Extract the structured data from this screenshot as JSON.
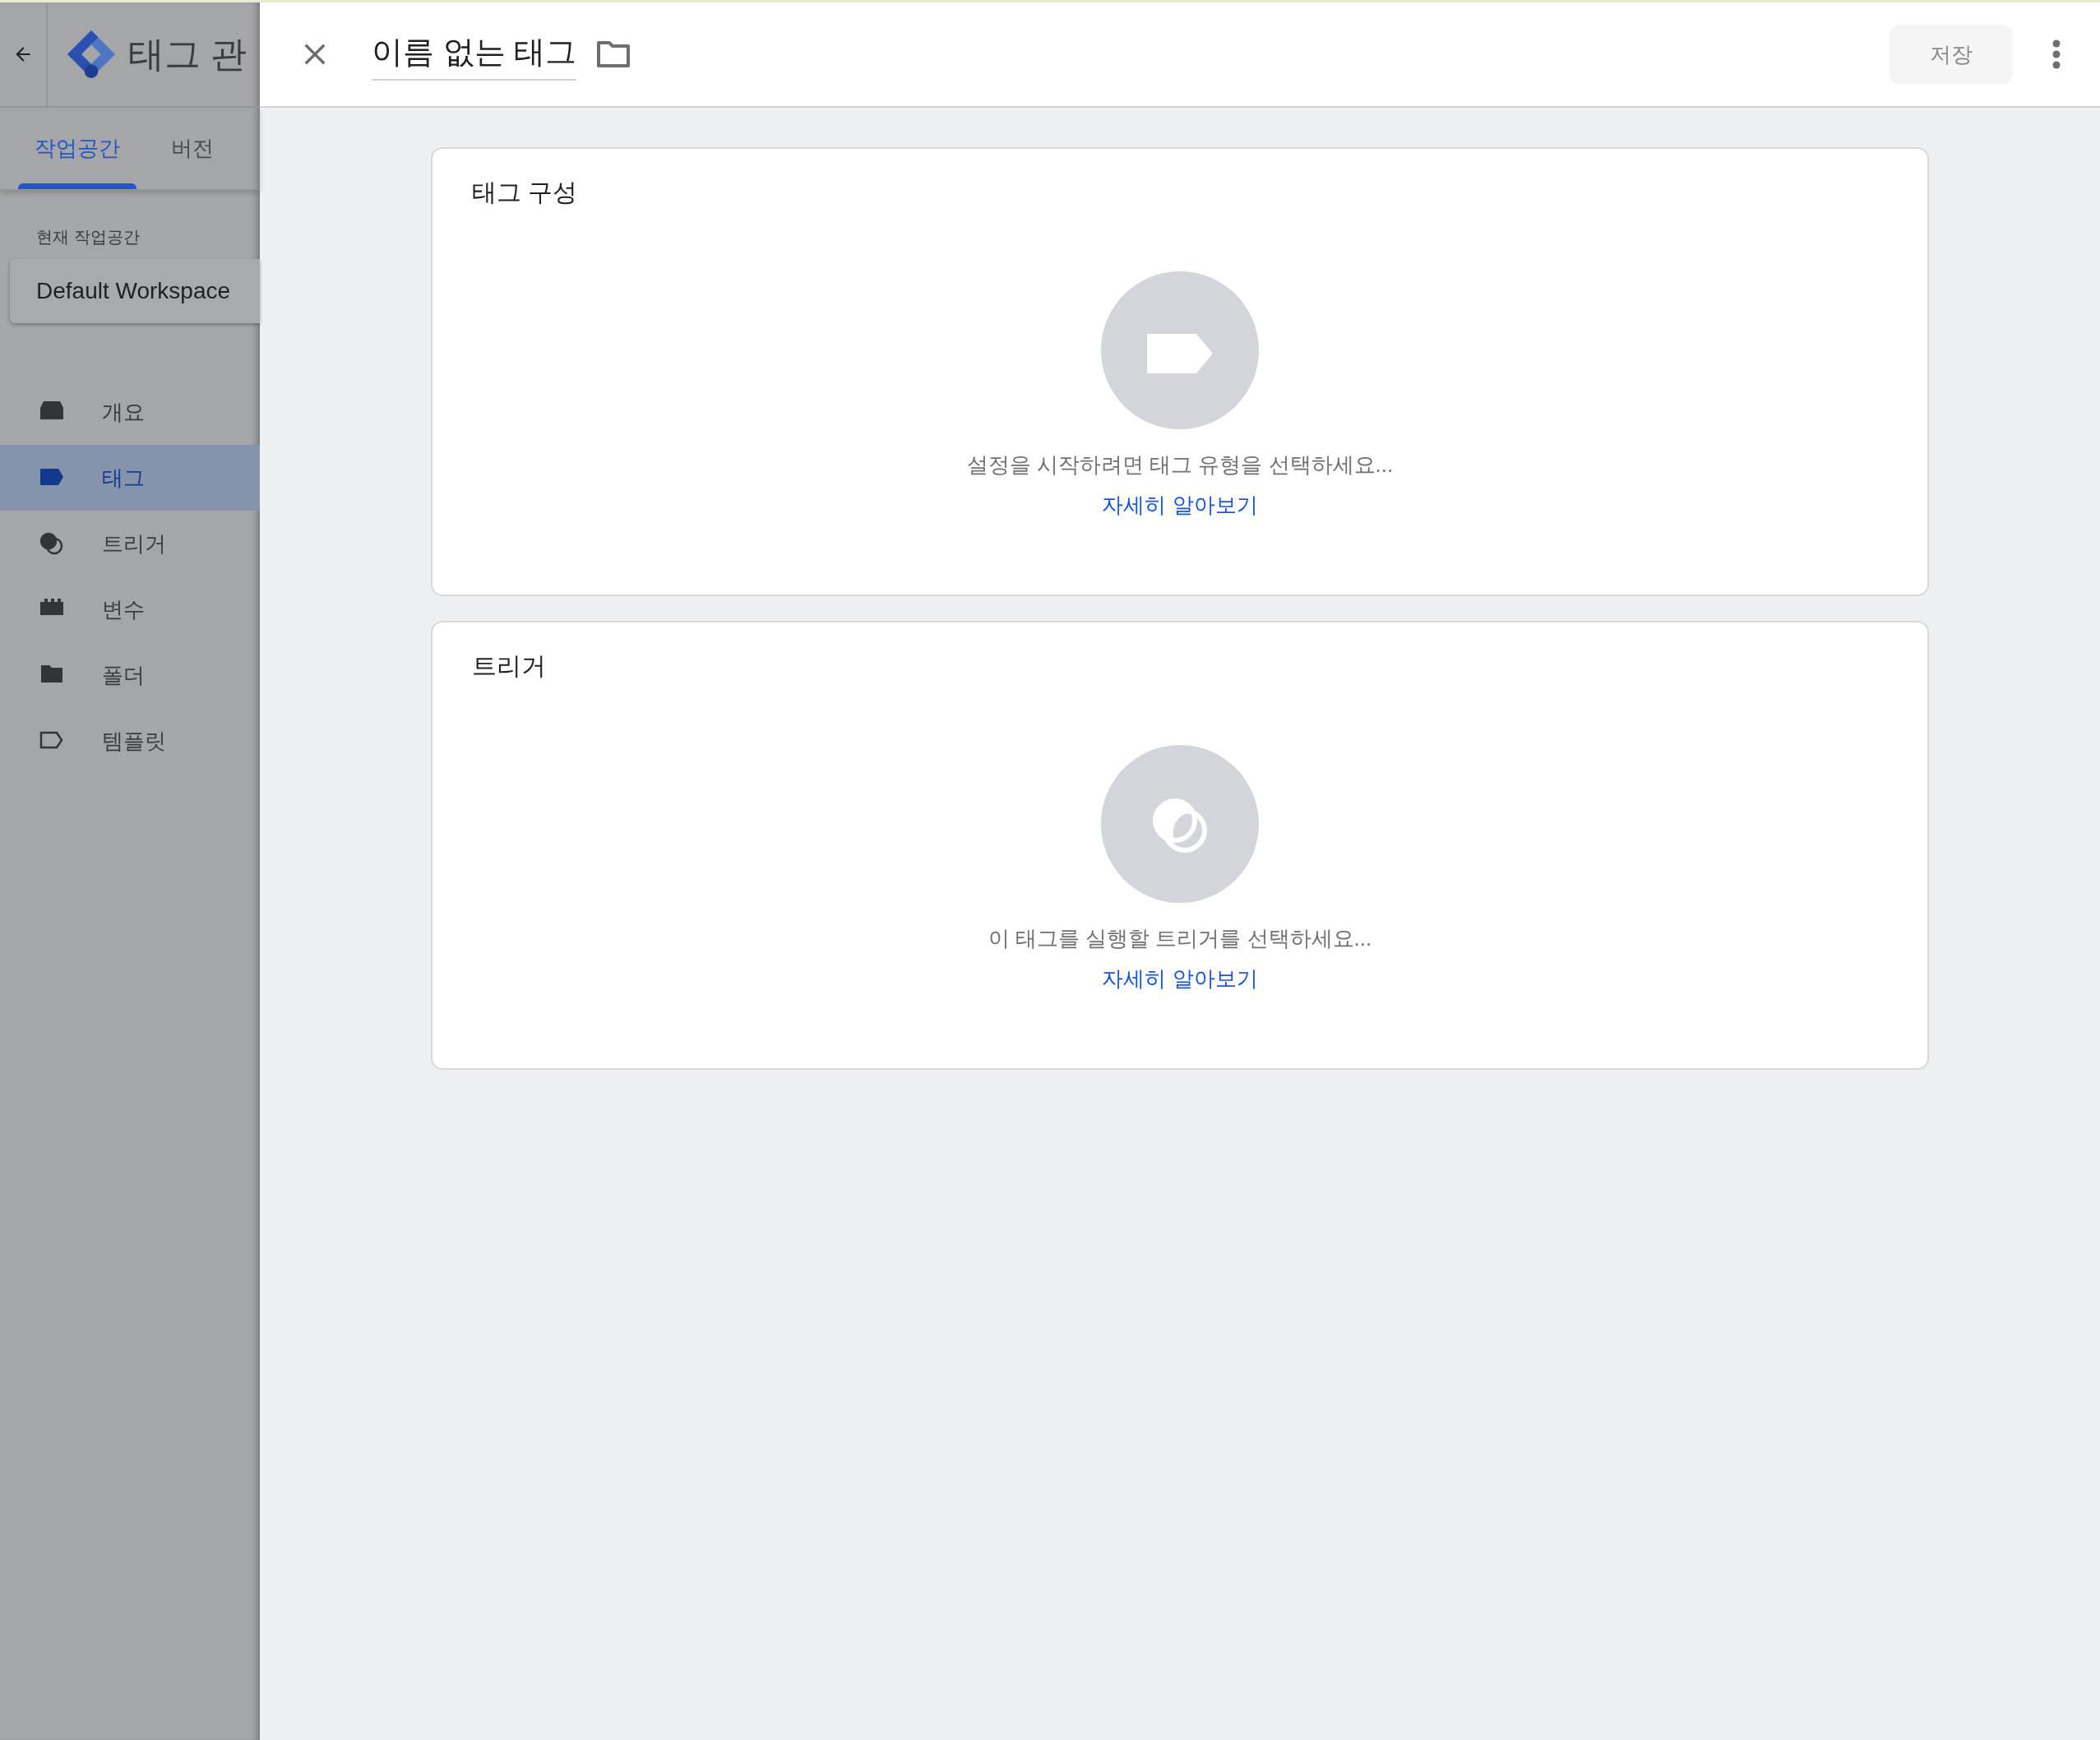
{
  "sidebar": {
    "app_title": "태그 관",
    "tabs": [
      {
        "label": "작업공간",
        "selected": true
      },
      {
        "label": "버전",
        "selected": false
      }
    ],
    "workspace_caption": "현재 작업공간",
    "workspace_name": "Default Workspace",
    "items": [
      {
        "label": "개요",
        "selected": false
      },
      {
        "label": "태그",
        "selected": true
      },
      {
        "label": "트리거",
        "selected": false
      },
      {
        "label": "변수",
        "selected": false
      },
      {
        "label": "폴더",
        "selected": false
      },
      {
        "label": "템플릿",
        "selected": false
      }
    ]
  },
  "editor": {
    "title": "이름 없는 태그",
    "save_button": {
      "label": "저장",
      "disabled": true
    },
    "cards": [
      {
        "kind": "tag",
        "title": "태그 구성",
        "hint": "설정을 시작하려면 태그 유형을 선택하세요...",
        "link": "자세히 알아보기"
      },
      {
        "kind": "trigger",
        "title": "트리거",
        "hint": "이 태그를 실행할 트리거를 선택하세요...",
        "link": "자세히 알아보기"
      }
    ]
  }
}
